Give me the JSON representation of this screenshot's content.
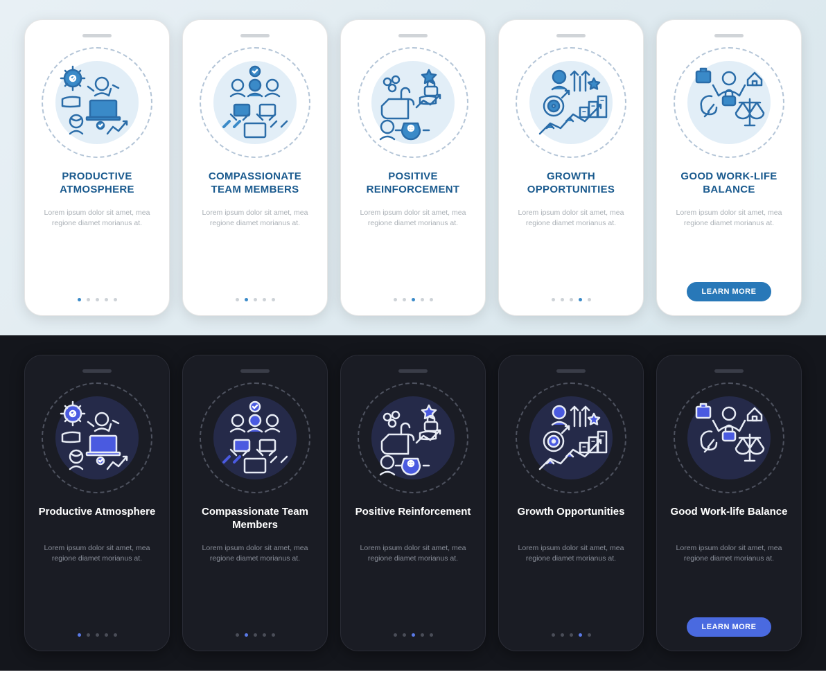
{
  "cta_label": "LEARN MORE",
  "light": {
    "screens": [
      {
        "title": "PRODUCTIVE ATMOSPHERE",
        "desc": "Lorem ipsum dolor sit amet, mea regione diamet morianus at.",
        "icon": "productive"
      },
      {
        "title": "COMPASSIONATE TEAM MEMBERS",
        "desc": "Lorem ipsum dolor sit amet, mea regione diamet morianus at.",
        "icon": "team"
      },
      {
        "title": "POSITIVE REINFORCEMENT",
        "desc": "Lorem ipsum dolor sit amet, mea regione diamet morianus at.",
        "icon": "positive"
      },
      {
        "title": "GROWTH OPPORTUNITIES",
        "desc": "Lorem ipsum dolor sit amet, mea regione diamet morianus at.",
        "icon": "growth"
      },
      {
        "title": "GOOD WORK-LIFE BALANCE",
        "desc": "Lorem ipsum dolor sit amet, mea regione diamet morianus at.",
        "icon": "balance"
      }
    ]
  },
  "dark": {
    "screens": [
      {
        "title": "Productive Atmosphere",
        "desc": "Lorem ipsum dolor sit amet, mea regione diamet morianus at.",
        "icon": "productive"
      },
      {
        "title": "Compassionate Team Members",
        "desc": "Lorem ipsum dolor sit amet, mea regione diamet morianus at.",
        "icon": "team"
      },
      {
        "title": "Positive Reinforcement",
        "desc": "Lorem ipsum dolor sit amet, mea regione diamet morianus at.",
        "icon": "positive"
      },
      {
        "title": "Growth Opportunities",
        "desc": "Lorem ipsum dolor sit amet, mea regione diamet morianus at.",
        "icon": "growth"
      },
      {
        "title": "Good Work-life Balance",
        "desc": "Lorem ipsum dolor sit amet, mea regione diamet morianus at.",
        "icon": "balance"
      }
    ]
  },
  "colors": {
    "accent_light": "#3a8ac8",
    "accent_dark": "#4a6ae0"
  }
}
